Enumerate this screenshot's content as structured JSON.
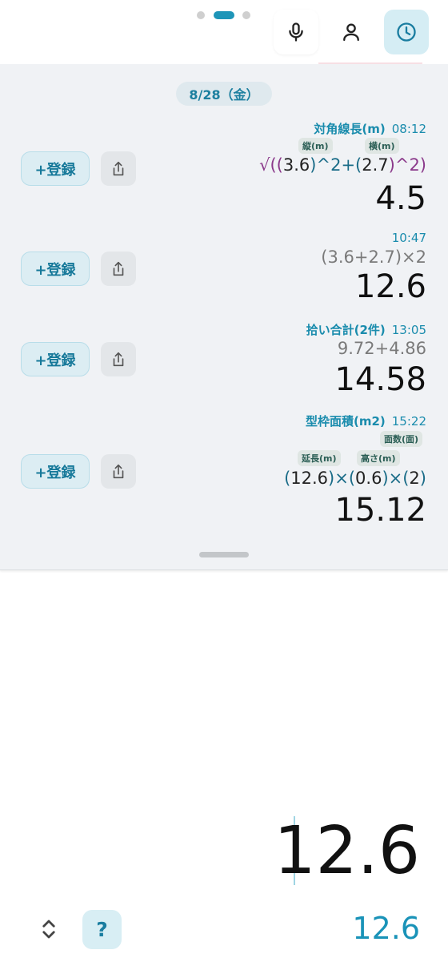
{
  "header": {
    "mic_icon": "mic-icon",
    "user_icon": "user-icon",
    "history_icon": "clock-icon",
    "accent": "#1e95b8"
  },
  "history": {
    "date": "8/28（金）",
    "register_label": "+登録",
    "entries": [
      {
        "title": "対角線長(m)",
        "time": "08:12",
        "labels": [
          "縦(m)",
          "横(m)"
        ],
        "expression": [
          "√((",
          "3.6",
          ")^2+(",
          "2.7",
          ")^2)"
        ],
        "result": "4.5"
      },
      {
        "title": "",
        "time": "10:47",
        "expression_plain": "(3.6+2.7)×2",
        "result": "12.6"
      },
      {
        "title": "拾い合計(2件)",
        "time": "13:05",
        "expression_plain": "9.72+4.86",
        "result": "14.58"
      },
      {
        "title": "型枠面積(m2)",
        "time": "15:22",
        "labels": [
          "延長(m)",
          "高さ(m)",
          "面数(面)"
        ],
        "expression": [
          "(",
          "12.6",
          ")×(",
          "0.6",
          ")×(",
          "2",
          ")"
        ],
        "result": "15.12"
      }
    ]
  },
  "display": {
    "value": "12.6",
    "preview": "12.6",
    "help_label": "?"
  }
}
